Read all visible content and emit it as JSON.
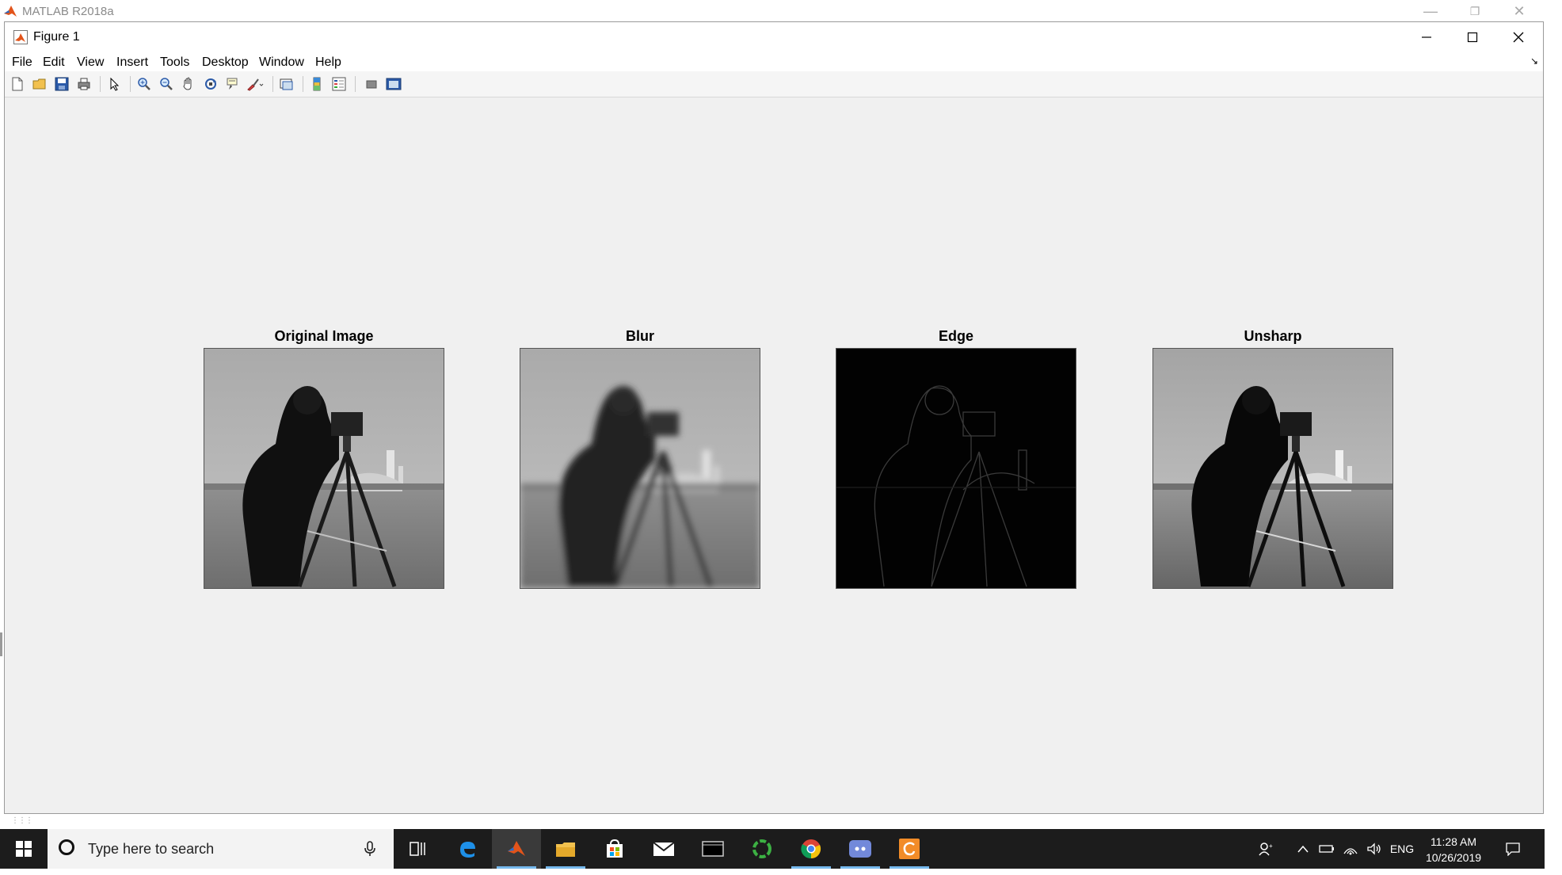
{
  "main_window": {
    "title": "MATLAB R2018a"
  },
  "figure_window": {
    "title": "Figure 1"
  },
  "menu": [
    "File",
    "Edit",
    "View",
    "Insert",
    "Tools",
    "Desktop",
    "Window",
    "Help"
  ],
  "toolbar_icons": [
    "new-figure-icon",
    "open-file-icon",
    "save-icon",
    "print-icon",
    "edit-plot-arrow-icon",
    "zoom-in-icon",
    "zoom-out-icon",
    "pan-hand-icon",
    "rotate-3d-icon",
    "data-cursor-icon",
    "brush-icon",
    "link-plot-icon",
    "colorbar-icon",
    "legend-icon",
    "hide-plot-tools-icon",
    "show-plot-tools-icon"
  ],
  "axes": [
    {
      "title": "Original Image",
      "variant": "original"
    },
    {
      "title": "Blur",
      "variant": "blur"
    },
    {
      "title": "Edge",
      "variant": "edge"
    },
    {
      "title": "Unsharp",
      "variant": "unsharp"
    }
  ],
  "taskbar": {
    "search_placeholder": "Type here to search",
    "apps": [
      "task-view-icon",
      "edge-browser-icon",
      "matlab-icon",
      "file-explorer-icon",
      "store-icon",
      "mail-icon",
      "terminal-icon",
      "green-ring-app-icon",
      "chrome-icon",
      "discord-icon",
      "orange-app-icon"
    ],
    "active_app": "matlab-icon",
    "language": "ENG",
    "time": "11:28 AM",
    "date": "10/26/2019"
  },
  "colors": {
    "taskbar": "#1c1c1c",
    "figure_bg": "#f0f0f0",
    "accent": "#76b9ed"
  }
}
